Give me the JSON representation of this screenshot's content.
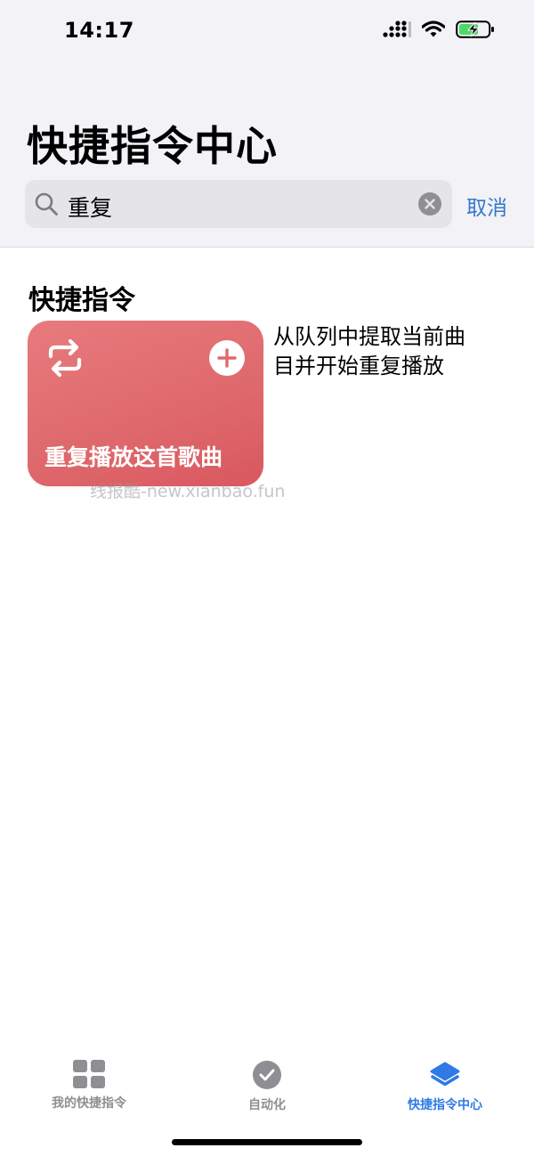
{
  "status_bar": {
    "time": "14:17"
  },
  "header": {
    "title": "快捷指令中心"
  },
  "search": {
    "query": "重复",
    "cancel_label": "取消"
  },
  "section": {
    "title": "快捷指令"
  },
  "shortcut_card": {
    "title": "重复播放这首歌曲",
    "description": "从队列中提取当前曲目并开始重复播放",
    "color": "#e06b6f"
  },
  "watermark": {
    "text": "线报酷-new.xianbao.fun"
  },
  "tab_bar": {
    "tabs": [
      {
        "label": "我的快捷指令",
        "icon": "grid-icon",
        "active": false
      },
      {
        "label": "自动化",
        "icon": "check-clock-icon",
        "active": false
      },
      {
        "label": "快捷指令中心",
        "icon": "layers-icon",
        "active": true
      }
    ],
    "active_color": "#2f7ae5",
    "inactive_color": "#8e8e93"
  }
}
